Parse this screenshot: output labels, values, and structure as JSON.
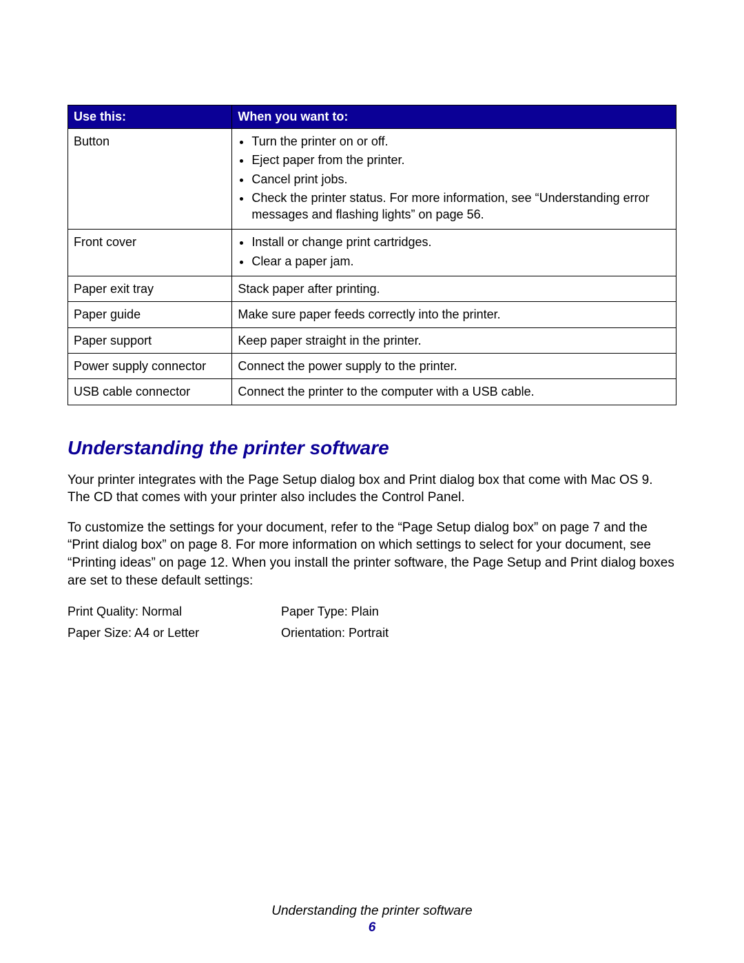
{
  "table": {
    "header": {
      "left": "Use this:",
      "right": "When you want to:"
    },
    "rows": [
      {
        "name": "Button",
        "items": [
          "Turn the printer on or off.",
          "Eject paper from the printer.",
          "Cancel print jobs.",
          "Check the printer status. For more information, see “Understanding error messages and flashing lights” on page 56."
        ]
      },
      {
        "name": "Front cover",
        "items": [
          "Install or change print cartridges.",
          "Clear a paper jam."
        ]
      },
      {
        "name": "Paper exit tray",
        "text": "Stack paper after printing."
      },
      {
        "name": "Paper guide",
        "text": "Make sure paper feeds correctly into the printer."
      },
      {
        "name": "Paper support",
        "text": "Keep paper straight in the printer."
      },
      {
        "name": "Power supply connector",
        "text": "Connect the power supply to the printer."
      },
      {
        "name": "USB cable connector",
        "text": "Connect the printer to the computer with a USB cable."
      }
    ]
  },
  "section_heading": "Understanding the printer software",
  "para1": "Your printer integrates with the Page Setup dialog box and Print dialog box that come with Mac OS 9. The CD that comes with your printer also includes the Control Panel.",
  "para2": "To customize the settings for your document, refer to the “Page Setup dialog box” on page 7 and the “Print dialog box” on page 8. For more information on which settings to select for your document, see “Printing ideas” on page 12. When you install the printer software, the Page Setup and Print dialog boxes are set to these default settings:",
  "defaults": {
    "print_quality": "Print Quality: Normal",
    "paper_type": "Paper Type: Plain",
    "paper_size": "Paper Size: A4 or Letter",
    "orientation": "Orientation: Portrait"
  },
  "footer_title": "Understanding the printer software",
  "page_number": "6"
}
